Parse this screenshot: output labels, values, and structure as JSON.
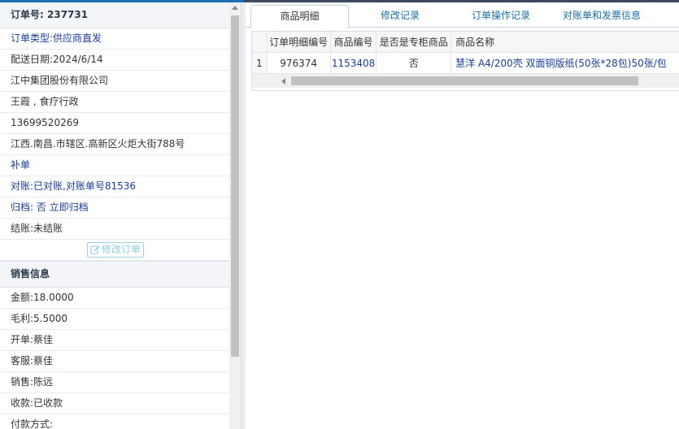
{
  "order": {
    "title_label": "订单号:",
    "title_value": "237731",
    "rows": [
      {
        "text": "订单类型:供应商直发",
        "style": "blue"
      },
      {
        "text": "配送日期:2024/6/14",
        "style": "dark"
      },
      {
        "text": "江中集团股份有限公司",
        "style": "dark"
      },
      {
        "text": "王霞 , 食疗行政",
        "style": "dark"
      },
      {
        "text": "13699520269",
        "style": "dark"
      },
      {
        "text": "江西.南昌.市辖区.高新区火炬大街788号",
        "style": "dark"
      },
      {
        "text": "补单",
        "style": "blue"
      },
      {
        "text": "对账:已对账,对账单号81536",
        "style": "blue"
      },
      {
        "text": "归档: 否 立即归档",
        "style": "blue"
      },
      {
        "text": "结账:未结账",
        "style": "dark"
      }
    ],
    "edit_button_label": "修改订单"
  },
  "sales": {
    "title": "销售信息",
    "rows": [
      {
        "text": "金额:18.0000"
      },
      {
        "text": "毛利:5.5000"
      },
      {
        "text": "开单:蔡佳"
      },
      {
        "text": "客服:蔡佳"
      },
      {
        "text": "销售:陈远"
      },
      {
        "text": "收款:已收款"
      },
      {
        "text": "付款方式:"
      }
    ]
  },
  "tabs": [
    {
      "label": "商品明细",
      "active": true
    },
    {
      "label": "修改记录",
      "active": false
    },
    {
      "label": "订单操作记录",
      "active": false
    },
    {
      "label": "对账单和发票信息",
      "active": false
    }
  ],
  "table": {
    "columns": [
      "订单明细编号",
      "商品编号",
      "是否是专柜商品",
      "商品名称"
    ],
    "rows": [
      {
        "rownum": "1",
        "detail_id": "976374",
        "product_id": "1153408",
        "is_counter": "否",
        "name": "慧洋 A4/200壳 双面铜版纸(50张*28包)50张/包"
      }
    ]
  },
  "colors": {
    "link_blue": "#1a3d9c",
    "tab_blue": "#1a6fa8",
    "header_bg": "#f3f5f8"
  }
}
